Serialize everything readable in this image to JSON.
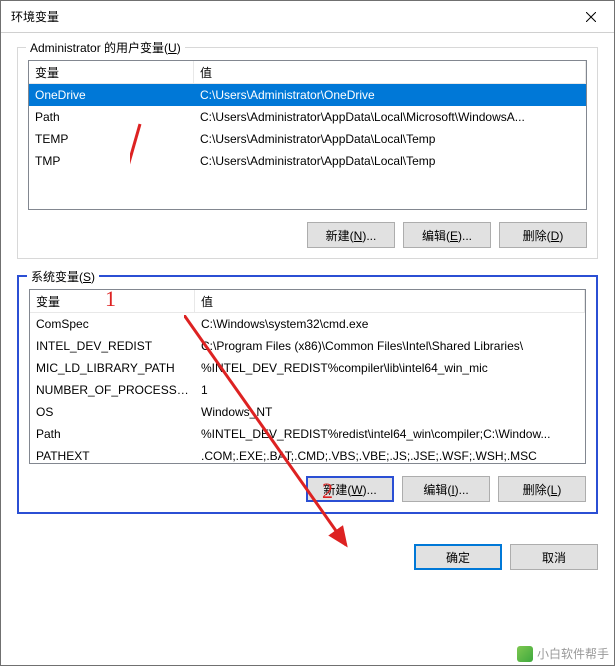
{
  "titlebar": {
    "title": "环境变量"
  },
  "user_vars": {
    "group_label_pre": "Administrator 的用户变量(",
    "group_label_key": "U",
    "group_label_post": ")",
    "col_name": "变量",
    "col_value": "值",
    "rows": [
      {
        "name": "OneDrive",
        "value": "C:\\Users\\Administrator\\OneDrive",
        "selected": true
      },
      {
        "name": "Path",
        "value": "C:\\Users\\Administrator\\AppData\\Local\\Microsoft\\WindowsA...",
        "selected": false
      },
      {
        "name": "TEMP",
        "value": "C:\\Users\\Administrator\\AppData\\Local\\Temp",
        "selected": false
      },
      {
        "name": "TMP",
        "value": "C:\\Users\\Administrator\\AppData\\Local\\Temp",
        "selected": false
      }
    ],
    "btn_new_pre": "新建(",
    "btn_new_key": "N",
    "btn_new_post": ")...",
    "btn_edit_pre": "编辑(",
    "btn_edit_key": "E",
    "btn_edit_post": ")...",
    "btn_delete_pre": "删除(",
    "btn_delete_key": "D",
    "btn_delete_post": ")"
  },
  "sys_vars": {
    "group_label_pre": "系统变量(",
    "group_label_key": "S",
    "group_label_post": ")",
    "col_name": "变量",
    "col_value": "值",
    "rows": [
      {
        "name": "ComSpec",
        "value": "C:\\Windows\\system32\\cmd.exe"
      },
      {
        "name": "INTEL_DEV_REDIST",
        "value": "C:\\Program Files (x86)\\Common Files\\Intel\\Shared Libraries\\"
      },
      {
        "name": "MIC_LD_LIBRARY_PATH",
        "value": "%INTEL_DEV_REDIST%compiler\\lib\\intel64_win_mic"
      },
      {
        "name": "NUMBER_OF_PROCESSORS",
        "value": "1"
      },
      {
        "name": "OS",
        "value": "Windows_NT"
      },
      {
        "name": "Path",
        "value": "%INTEL_DEV_REDIST%redist\\intel64_win\\compiler;C:\\Window..."
      },
      {
        "name": "PATHEXT",
        "value": ".COM;.EXE;.BAT;.CMD;.VBS;.VBE;.JS;.JSE;.WSF;.WSH;.MSC"
      }
    ],
    "btn_new_pre": "新建(",
    "btn_new_key": "W",
    "btn_new_post": ")...",
    "btn_edit_pre": "编辑(",
    "btn_edit_key": "I",
    "btn_edit_post": ")...",
    "btn_delete_pre": "删除(",
    "btn_delete_key": "L",
    "btn_delete_post": ")"
  },
  "footer": {
    "ok": "确定",
    "cancel": "取消"
  },
  "annotations": {
    "label1": "1",
    "label2": "2"
  },
  "watermark": {
    "text": "小白软件帮手"
  }
}
